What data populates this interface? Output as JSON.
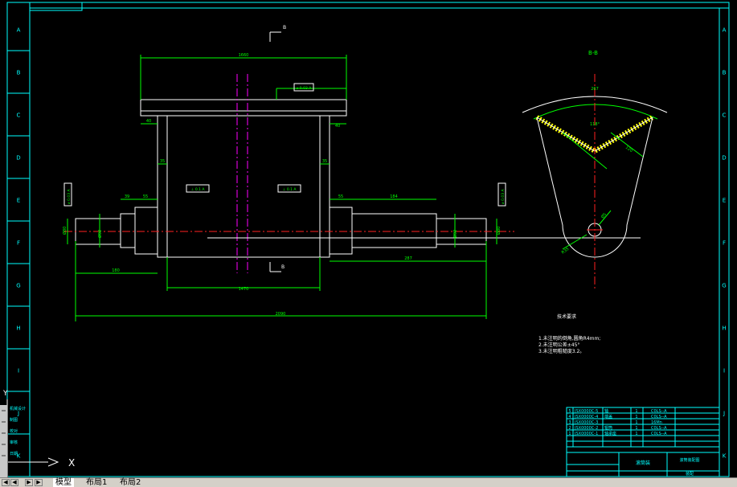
{
  "drawing": {
    "colors": {
      "background": "#000000",
      "border": "#00ffff",
      "geometry": "#ffffff",
      "dimension": "#00ff00",
      "centerline": "#ff2020",
      "center_magenta": "#ff00ff",
      "hatch": "#ffff00"
    },
    "border_labels": [
      "A",
      "B",
      "C",
      "D",
      "E",
      "F",
      "G",
      "H",
      "I",
      "J",
      "K"
    ],
    "dimensions": {
      "top_width": "1660",
      "flange_left": "40",
      "flange_right": "40",
      "inner_left": "35",
      "inner_right": "35",
      "shaft_left_a": "39",
      "shaft_left_b": "55",
      "shaft_right_a": "55",
      "shaft_right_b": "184",
      "dia_left_end": "Ø80",
      "dia_left_step": "Ø92",
      "dia_right_step": "Ø92",
      "dia_right_end": "Ø80",
      "len_left": "180",
      "len_right": "287",
      "drum_length": "1470",
      "total_length": "2090"
    },
    "tolerance_frames": [
      {
        "id": "top",
        "text": "⌀ 0.03 A"
      },
      {
        "id": "mid-left",
        "text": "⊥ 0.1 A"
      },
      {
        "id": "mid-right",
        "text": "⊥ 0.1 A"
      },
      {
        "id": "left-end",
        "text": "⌀ 0.03 A"
      },
      {
        "id": "right-end",
        "text": "⌀ 0.03 A"
      }
    ],
    "section_marker": "B",
    "section_title": "B-B",
    "section_dims": {
      "arc_top": "267",
      "angle": "118°",
      "side": "120",
      "radius": "R35",
      "hole": "Ø5"
    },
    "notes": {
      "title": "技术要求",
      "items": [
        "1.未注明的倒角,圆角R4mm;",
        "2.未注明公差±45°",
        "3.未注明粗糙度3.2。"
      ]
    },
    "bom": {
      "rows": [
        {
          "no": "5",
          "code": "JSX0000C-5",
          "name": "轴",
          "qty": "1",
          "mat": "C0LS--A"
        },
        {
          "no": "4",
          "code": "JSX0000C-4",
          "name": "端盖",
          "qty": "1",
          "mat": "C0LS--A"
        },
        {
          "no": "3",
          "code": "JSX0000C-3",
          "name": "",
          "qty": "1",
          "mat": "16Mn"
        },
        {
          "no": "2",
          "code": "JSX0000C-2",
          "name": "辊筒",
          "qty": "1",
          "mat": "C0LS--A"
        },
        {
          "no": "1",
          "code": "JSX0000C-1",
          "name": "轴承座",
          "qty": "1",
          "mat": "C0LS--A"
        }
      ],
      "title_block": {
        "part_name": "滚筒装",
        "drawing_no": "滚筒装配图",
        "company": "装配"
      }
    },
    "ucs": {
      "y": "Y",
      "x": "X"
    }
  },
  "left_panel": {
    "items": [
      "机械设计",
      "制图",
      "校对",
      "审核",
      "日期"
    ]
  },
  "tabs": {
    "nav": [
      "◀",
      "◀",
      "▶",
      "▶"
    ],
    "items": [
      {
        "label": "模型",
        "active": true
      },
      {
        "label": "布局1",
        "active": false
      },
      {
        "label": "布局2",
        "active": false
      }
    ]
  }
}
